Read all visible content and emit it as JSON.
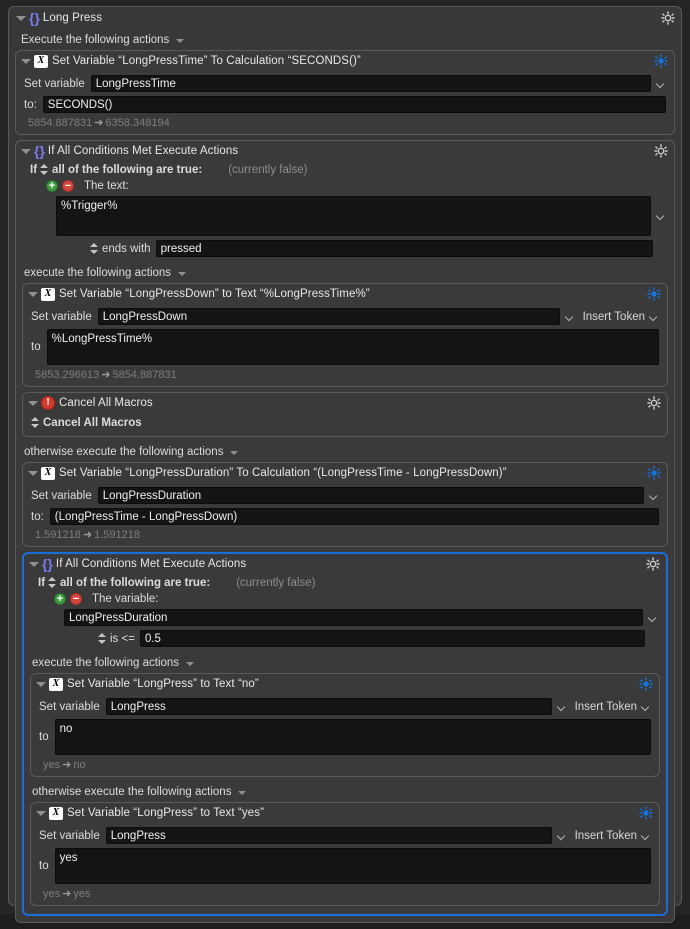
{
  "macro": {
    "title": "Long Press",
    "icon": "braces-icon",
    "execute_label": "Execute the following actions",
    "gear": "gear-icon"
  },
  "labels": {
    "set_variable": "Set variable",
    "to_colon": "to:",
    "to": "to",
    "insert_token": "Insert Token",
    "if_prefix": "If",
    "all_true": "all of the following are true:",
    "currently_false": "(currently false)",
    "execute_following": "execute the following actions",
    "otherwise_execute": "otherwise execute the following actions"
  },
  "actions": {
    "set_longpresstime": {
      "title": "Set Variable “LongPressTime” To Calculation “SECONDS()”",
      "variable": "LongPressTime",
      "value": "SECONDS()",
      "result_before": "5854.887831",
      "result_after": "6358.348194"
    },
    "if_trigger": {
      "title": "If All Conditions Met Execute Actions",
      "condition_label": "The text:",
      "condition_value": "%Trigger%",
      "operator": "ends with",
      "operand": "pressed"
    },
    "set_longpressdown": {
      "title": "Set Variable “LongPressDown” to Text “%LongPressTime%”",
      "variable": "LongPressDown",
      "value": "%LongPressTime%",
      "result_before": "5853.296613",
      "result_after": "5854.887831"
    },
    "cancel_all_macros": {
      "title": "Cancel All Macros",
      "option": "Cancel All Macros"
    },
    "set_longpressduration": {
      "title": "Set Variable “LongPressDuration” To Calculation “(LongPressTime - LongPressDown)”",
      "variable": "LongPressDuration",
      "value": "(LongPressTime - LongPressDown)",
      "result_before": "1.591218",
      "result_after": "1.591218"
    },
    "if_duration": {
      "title": "If All Conditions Met Execute Actions",
      "condition_label": "The variable:",
      "condition_value": "LongPressDuration",
      "operator": "is <=",
      "operand": "0.5"
    },
    "set_longpress_no": {
      "title": "Set Variable “LongPress” to Text “no”",
      "variable": "LongPress",
      "value": "no",
      "result_before": "yes",
      "result_after": "no"
    },
    "set_longpress_yes": {
      "title": "Set Variable “LongPress” to Text “yes”",
      "variable": "LongPress",
      "value": "yes",
      "result_before": "yes",
      "result_after": "yes"
    }
  },
  "icons": {
    "braces": "{}",
    "variable": "X",
    "cancel": "!",
    "arrow": "➜"
  },
  "colors": {
    "accent_selection": "#1a6dd8",
    "gear_active": "#1474e0",
    "gear_inactive": "#d0d0d0",
    "braces": "#7b7bf0",
    "plus": "#3f9c40",
    "minus": "#d4453c",
    "cancel": "#d63a2e"
  }
}
